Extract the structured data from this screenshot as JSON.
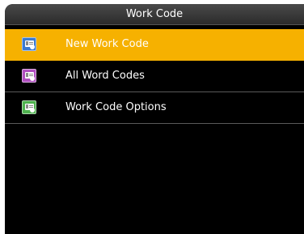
{
  "header": {
    "title": "Work Code"
  },
  "menu": {
    "items": [
      {
        "label": "New Work Code",
        "icon": "new-work-code-icon",
        "selected": true
      },
      {
        "label": "All Word Codes",
        "icon": "all-work-codes-icon",
        "selected": false
      },
      {
        "label": "Work Code Options",
        "icon": "work-code-options-icon",
        "selected": false
      }
    ]
  },
  "colors": {
    "selected_bg": "#f6b100",
    "background": "#000000",
    "text": "#ffffff"
  }
}
